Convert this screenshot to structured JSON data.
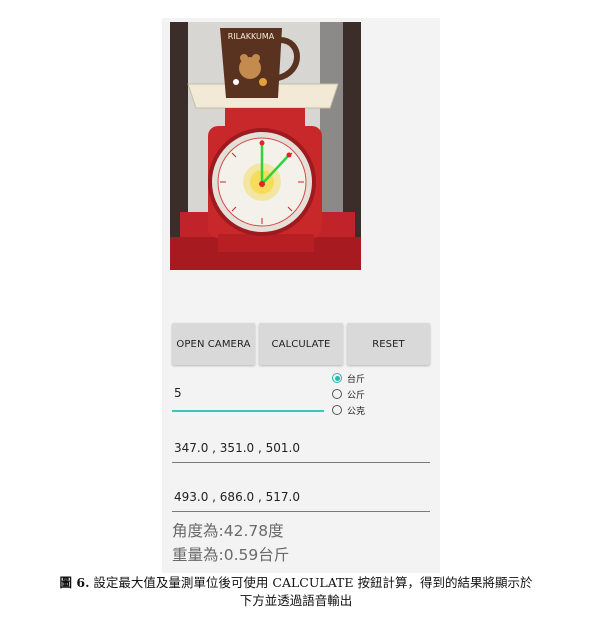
{
  "photo": {
    "mug_brand": "RILAKKUMA"
  },
  "buttons": {
    "open_camera": "OPEN CAMERA",
    "calculate": "CALCULATE",
    "reset": "RESET"
  },
  "max_value_input": {
    "value": "5"
  },
  "units": {
    "options": [
      "台斤",
      "公斤",
      "公克"
    ],
    "selected": "台斤"
  },
  "coordinates": {
    "field_1": "347.0 , 351.0 , 501.0",
    "field_2": "493.0 , 686.0 , 517.0"
  },
  "results": {
    "angle": "角度為:42.78度",
    "weight": "重量為:0.59台斤"
  },
  "caption": {
    "label": "圖 6.",
    "line_1": "設定最大值及量測單位後可使用 CALCULATE 按鈕計算，得到的結果將顯示於",
    "line_2": "下方並透過語音輸出"
  },
  "colors": {
    "accent": "#2bb8b0",
    "input_underline": "#3fc4bd",
    "scale_red": "#c8282a",
    "detected_line": "#33d13a"
  }
}
